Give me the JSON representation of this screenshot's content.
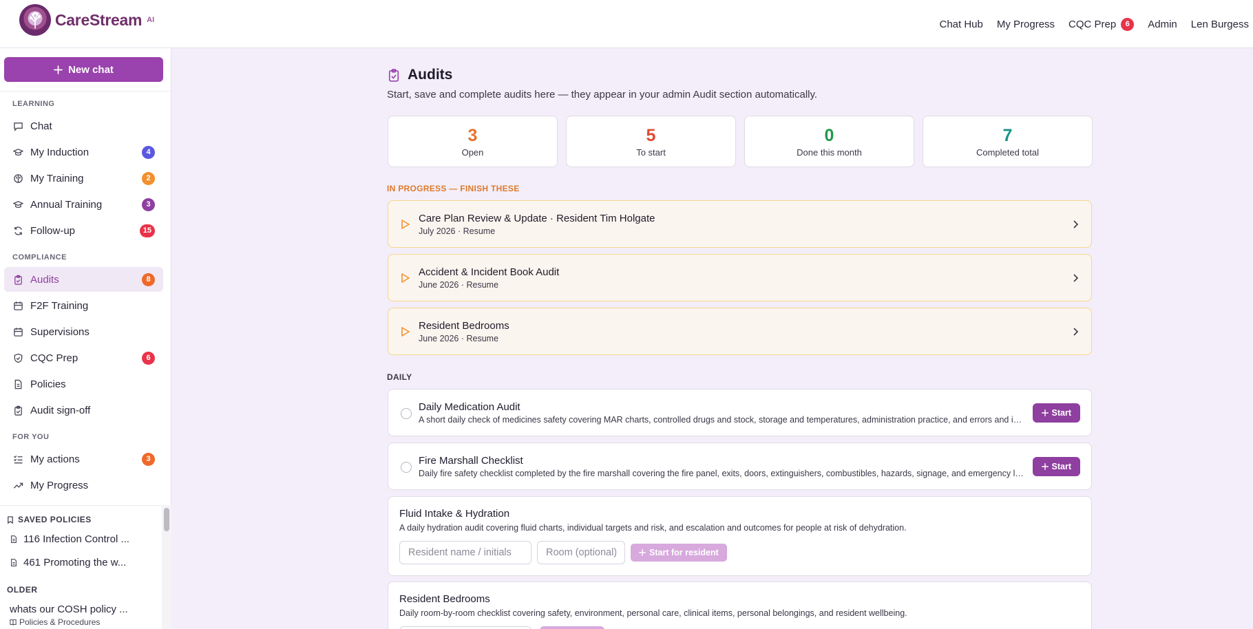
{
  "brand": {
    "name": "CareStream",
    "suffix": "AI"
  },
  "topnav": {
    "chat_hub": "Chat Hub",
    "my_progress": "My Progress",
    "cqc_prep": "CQC Prep",
    "cqc_badge": "6",
    "admin": "Admin",
    "user": "Len Burgess"
  },
  "sidebar": {
    "new_chat": "New chat",
    "sections": {
      "learning": "LEARNING",
      "compliance": "COMPLIANCE",
      "for_you": "FOR YOU"
    },
    "items": [
      {
        "label": "Chat",
        "icon": "chat-bubble-icon",
        "badge": ""
      },
      {
        "label": "My Induction",
        "icon": "graduation-cap-icon",
        "badge": "4",
        "badge_color": "#5a58e0"
      },
      {
        "label": "My Training",
        "icon": "brain-icon",
        "badge": "2",
        "badge_color": "#f2902e"
      },
      {
        "label": "Annual Training",
        "icon": "graduation-cap-icon",
        "badge": "3",
        "badge_color": "#8e3f9f"
      },
      {
        "label": "Follow-up",
        "icon": "refresh-icon",
        "badge": "15",
        "badge_color": "#e8334a"
      },
      {
        "label": "Audits",
        "icon": "clipboard-check-icon",
        "badge": "8",
        "badge_color": "#ee6a2a"
      },
      {
        "label": "F2F Training",
        "icon": "calendar-icon",
        "badge": ""
      },
      {
        "label": "Supervisions",
        "icon": "calendar-icon",
        "badge": ""
      },
      {
        "label": "CQC Prep",
        "icon": "shield-check-icon",
        "badge": "6",
        "badge_color": "#e8334a"
      },
      {
        "label": "Policies",
        "icon": "document-icon",
        "badge": ""
      },
      {
        "label": "Audit sign-off",
        "icon": "clipboard-check-icon",
        "badge": ""
      },
      {
        "label": "My actions",
        "icon": "list-check-icon",
        "badge": "3",
        "badge_color": "#ee6a2a"
      },
      {
        "label": "My Progress",
        "icon": "trending-up-icon",
        "badge": ""
      }
    ],
    "saved_label": "SAVED POLICIES",
    "saved": [
      "116 Infection Control ...",
      "461 Promoting the w..."
    ],
    "older_label": "OLDER",
    "older_item": "whats our COSH policy ...",
    "older_sub": "Policies & Procedures"
  },
  "main": {
    "title": "Audits",
    "subtitle": "Start, save and complete audits here — they appear in your admin Audit section automatically.",
    "stats": [
      {
        "value": "3",
        "label": "Open",
        "color": "#e8712a"
      },
      {
        "value": "5",
        "label": "To start",
        "color": "#e04a2e"
      },
      {
        "value": "0",
        "label": "Done this month",
        "color": "#1f9a4a"
      },
      {
        "value": "7",
        "label": "Completed total",
        "color": "#1a9488"
      }
    ],
    "in_progress_label": "IN PROGRESS — FINISH THESE",
    "in_progress": [
      {
        "title": "Care Plan Review & Update · Resident Tim Holgate",
        "meta": "July 2026 · Resume"
      },
      {
        "title": "Accident & Incident Book Audit",
        "meta": "June 2026 · Resume"
      },
      {
        "title": "Resident Bedrooms",
        "meta": "June 2026 · Resume"
      }
    ],
    "daily_label": "DAILY",
    "daily": [
      {
        "title": "Daily Medication Audit",
        "desc": "A short daily check of medicines safety covering MAR charts, controlled drugs and stock, storage and temperatures, administration practice, and errors and incidents.",
        "button": "Start"
      },
      {
        "title": "Fire Marshall Checklist",
        "desc": "Daily fire safety checklist completed by the fire marshall covering the fire panel, exits, doors, extinguishers, combustibles, hazards, signage, and emergency lighting.",
        "button": "Start"
      }
    ],
    "fluid": {
      "title": "Fluid Intake & Hydration",
      "desc": "A daily hydration audit covering fluid charts, individual targets and risk, and escalation and outcomes for people at risk of dehydration.",
      "name_placeholder": "Resident name / initials",
      "room_placeholder": "Room (optional)",
      "button": "Start for resident"
    },
    "bedrooms": {
      "title": "Resident Bedrooms",
      "desc": "Daily room-by-room checklist covering safety, environment, personal care, clinical items, personal belongings, and resident wellbeing."
    }
  }
}
